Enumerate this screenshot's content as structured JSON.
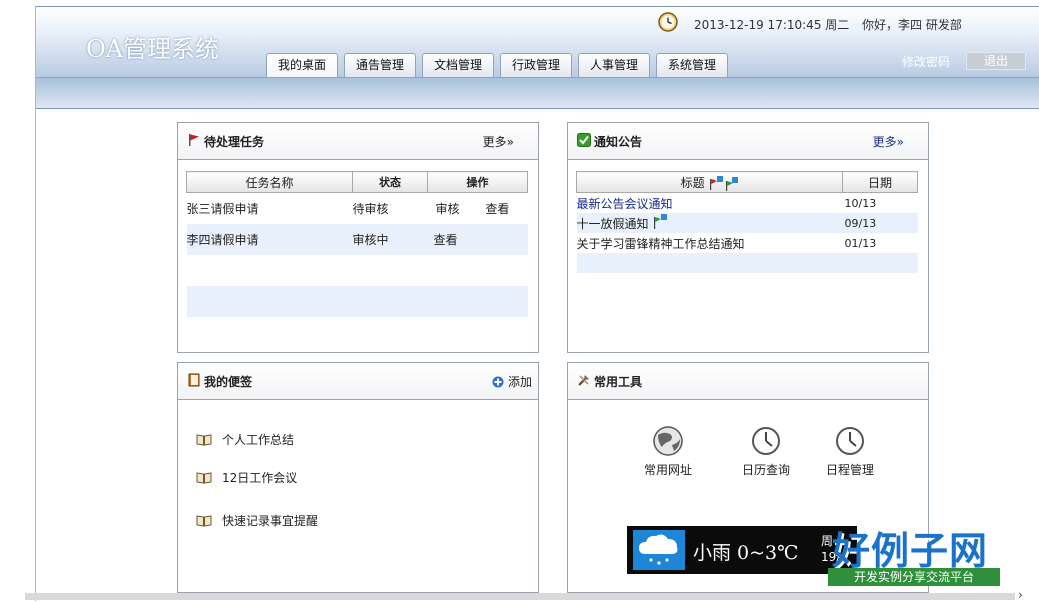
{
  "header": {
    "logo": "OA管理系统",
    "datetime": "2013-12-19 17:10:45 周二",
    "greeting": "你好，李四 研发部",
    "change_password": "修改密码",
    "logout": "退出"
  },
  "tabs": [
    {
      "label": "我的桌面",
      "active": true
    },
    {
      "label": "通告管理"
    },
    {
      "label": "文档管理"
    },
    {
      "label": "行政管理"
    },
    {
      "label": "人事管理"
    },
    {
      "label": "系统管理"
    }
  ],
  "tasks": {
    "title": "待处理任务",
    "more": "更多»",
    "columns": [
      "任务名称",
      "状态",
      "操作"
    ],
    "rows": [
      {
        "name": "张三请假申请",
        "status": "待审核",
        "actions": [
          "审核",
          "查看"
        ]
      },
      {
        "name": "李四请假申请",
        "status": "审核中",
        "actions": [
          "查看"
        ]
      }
    ]
  },
  "notices": {
    "title": "通知公告",
    "more": "更多»",
    "columns": [
      "标题",
      "日期"
    ],
    "rows": [
      {
        "title": "最新公告会议通知",
        "date": "10/13"
      },
      {
        "title": "十一放假通知",
        "date": "09/13"
      },
      {
        "title": "关于学习雷锋精神工作总结通知",
        "date": "01/13"
      }
    ]
  },
  "memos": {
    "title": "我的便签",
    "add": "添加",
    "items": [
      "个人工作总结",
      "12日工作会议",
      "快速记录事宜提醒"
    ]
  },
  "tools": {
    "title": "常用工具",
    "items": [
      "常用网址",
      "日历查询",
      "日程管理"
    ]
  },
  "weather": {
    "temp": "小雨 0~3℃",
    "day": "周",
    "date": "19/"
  },
  "watermark": {
    "big": "好例子网",
    "small": "开发实例分享交流平台"
  },
  "colors": {
    "header_top": "#ffffff",
    "header_bottom": "#b9cbe2",
    "row_alt": "#e8f0fb",
    "link_blue": "#142a8c",
    "badge_blue": "#1b73c9",
    "badge_green": "#2f8f3a"
  }
}
